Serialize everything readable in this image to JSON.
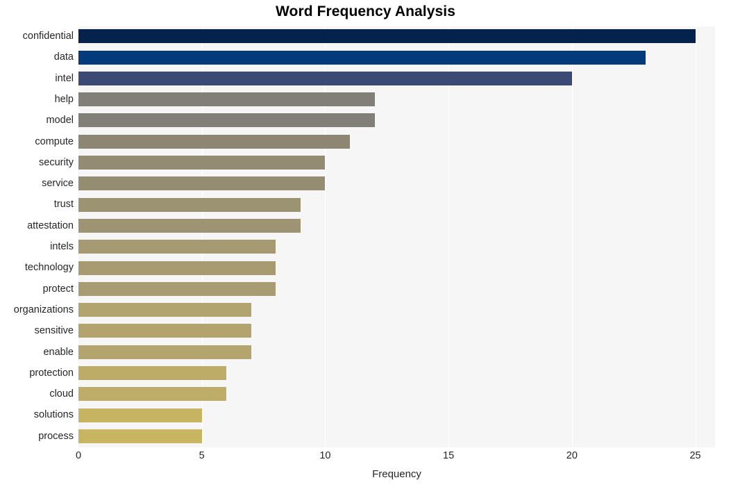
{
  "chart_data": {
    "type": "bar",
    "orientation": "horizontal",
    "title": "Word Frequency Analysis",
    "xlabel": "Frequency",
    "ylabel": "",
    "xlim": [
      0,
      25.8
    ],
    "xticks": [
      0,
      5,
      10,
      15,
      20,
      25
    ],
    "xtick_labels": [
      "0",
      "5",
      "10",
      "15",
      "20",
      "25"
    ],
    "grid": true,
    "grid_axis": "x",
    "legend": null,
    "categories": [
      "confidential",
      "data",
      "intel",
      "help",
      "model",
      "compute",
      "security",
      "service",
      "trust",
      "attestation",
      "intels",
      "technology",
      "protect",
      "organizations",
      "sensitive",
      "enable",
      "protection",
      "cloud",
      "solutions",
      "process"
    ],
    "values": [
      25,
      23,
      20,
      12,
      12,
      11,
      10,
      10,
      9,
      9,
      8,
      8,
      8,
      7,
      7,
      7,
      6,
      6,
      5,
      5
    ],
    "bar_colors": [
      "#04234c",
      "#033a7b",
      "#3b4a74",
      "#827f79",
      "#827f78",
      "#8c8673",
      "#938c72",
      "#958d72",
      "#9c9373",
      "#9e9473",
      "#a69a72",
      "#a79b72",
      "#a89c72",
      "#b2a46f",
      "#b3a46f",
      "#b4a56f",
      "#bdac68",
      "#bead68",
      "#c6b463",
      "#c7b562"
    ],
    "plot_background": "#f6f6f6",
    "figure_background": "#ffffff",
    "gridline_color": "#ffffff",
    "text_color": "#262626"
  }
}
